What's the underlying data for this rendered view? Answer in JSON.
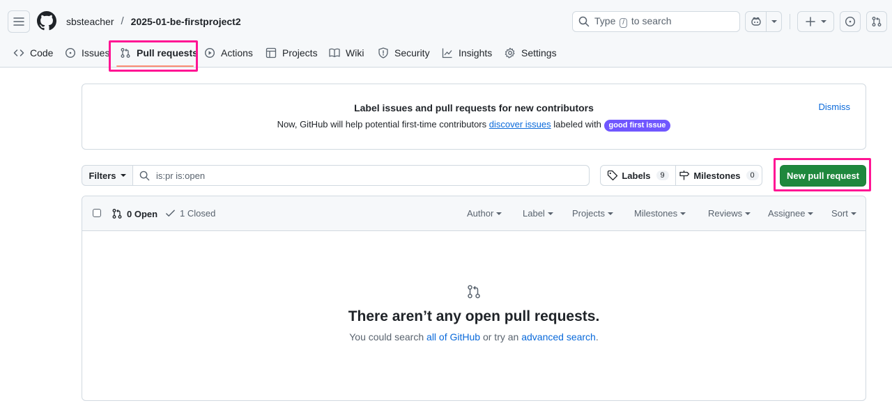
{
  "header": {
    "owner": "sbsteacher",
    "separator": "/",
    "repo": "2025-01-be-firstproject2",
    "search_before": "Type",
    "search_key": "/",
    "search_after": "to search"
  },
  "nav": {
    "tabs": [
      {
        "label": "Code",
        "icon": "code-icon"
      },
      {
        "label": "Issues",
        "icon": "issue-opened-icon"
      },
      {
        "label": "Pull requests",
        "icon": "git-pull-request-icon",
        "active": true
      },
      {
        "label": "Actions",
        "icon": "play-icon"
      },
      {
        "label": "Projects",
        "icon": "table-icon"
      },
      {
        "label": "Wiki",
        "icon": "book-icon"
      },
      {
        "label": "Security",
        "icon": "shield-icon"
      },
      {
        "label": "Insights",
        "icon": "graph-icon"
      },
      {
        "label": "Settings",
        "icon": "gear-icon"
      }
    ]
  },
  "banner": {
    "title": "Label issues and pull requests for new contributors",
    "text_before": "Now, GitHub will help potential first-time contributors",
    "link": "discover issues",
    "text_after": "labeled with",
    "label": "good first issue",
    "label_color": "#7057ff",
    "dismiss": "Dismiss"
  },
  "filters": {
    "button": "Filters",
    "query": "is:pr is:open",
    "labels": "Labels",
    "labels_count": "9",
    "milestones": "Milestones",
    "milestones_count": "0",
    "new_pr": "New pull request"
  },
  "list": {
    "open": "0 Open",
    "closed": "1 Closed",
    "menus": [
      "Author",
      "Label",
      "Projects",
      "Milestones",
      "Reviews",
      "Assignee",
      "Sort"
    ],
    "empty_title": "There aren’t any open pull requests.",
    "empty_before": "You could search",
    "empty_link1": "all of GitHub",
    "empty_middle": "or try an",
    "empty_link2": "advanced search",
    "empty_end": "."
  },
  "colors": {
    "accent": "#0969da",
    "primary_button": "#1f883d",
    "highlight": "#ff1493",
    "active_tab_underline": "#fd8c73"
  }
}
